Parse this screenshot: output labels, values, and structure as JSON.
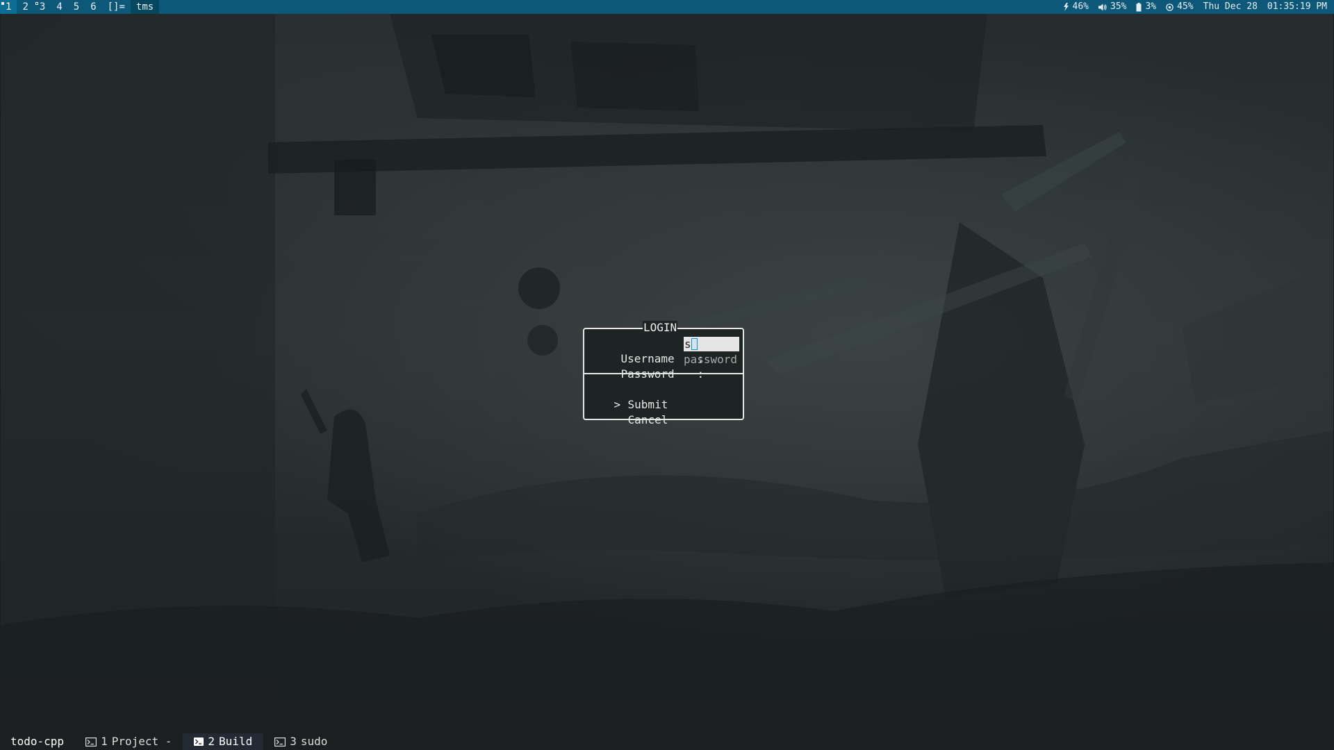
{
  "topbar": {
    "workspaces": [
      {
        "label": "1",
        "active": true,
        "indicator": "filled"
      },
      {
        "label": "2",
        "active": false,
        "indicator": "none"
      },
      {
        "label": "3",
        "active": false,
        "indicator": "hollow"
      },
      {
        "label": "4",
        "active": false,
        "indicator": "none"
      },
      {
        "label": "5",
        "active": false,
        "indicator": "none"
      },
      {
        "label": "6",
        "active": false,
        "indicator": "none"
      }
    ],
    "layout_symbol": "[]=",
    "window_title": "tms",
    "status": {
      "brightness": "46%",
      "volume": "35%",
      "battery": "3%",
      "cpu": "45%",
      "date": "Thu Dec 28",
      "time": "01:35:19 PM"
    }
  },
  "login": {
    "title": "LOGIN",
    "username_label": "Username",
    "password_label": "Password",
    "separator": ":",
    "username_value": "s",
    "password_placeholder": "password",
    "pointer": ">",
    "submit_label": "Submit",
    "cancel_label": "Cancel"
  },
  "tmux": {
    "session": "todo-cpp",
    "windows": [
      {
        "index": "1",
        "name": "Project -",
        "active": false
      },
      {
        "index": "2",
        "name": "Build",
        "active": true
      },
      {
        "index": "3",
        "name": "sudo",
        "active": false
      }
    ]
  },
  "colors": {
    "topbar": "#0d5878",
    "topbar_active": "#0a6d93",
    "dialog_border": "#e7e7e7",
    "input_bg": "#e4e4e4",
    "cursor_border": "#1a8fd0"
  }
}
